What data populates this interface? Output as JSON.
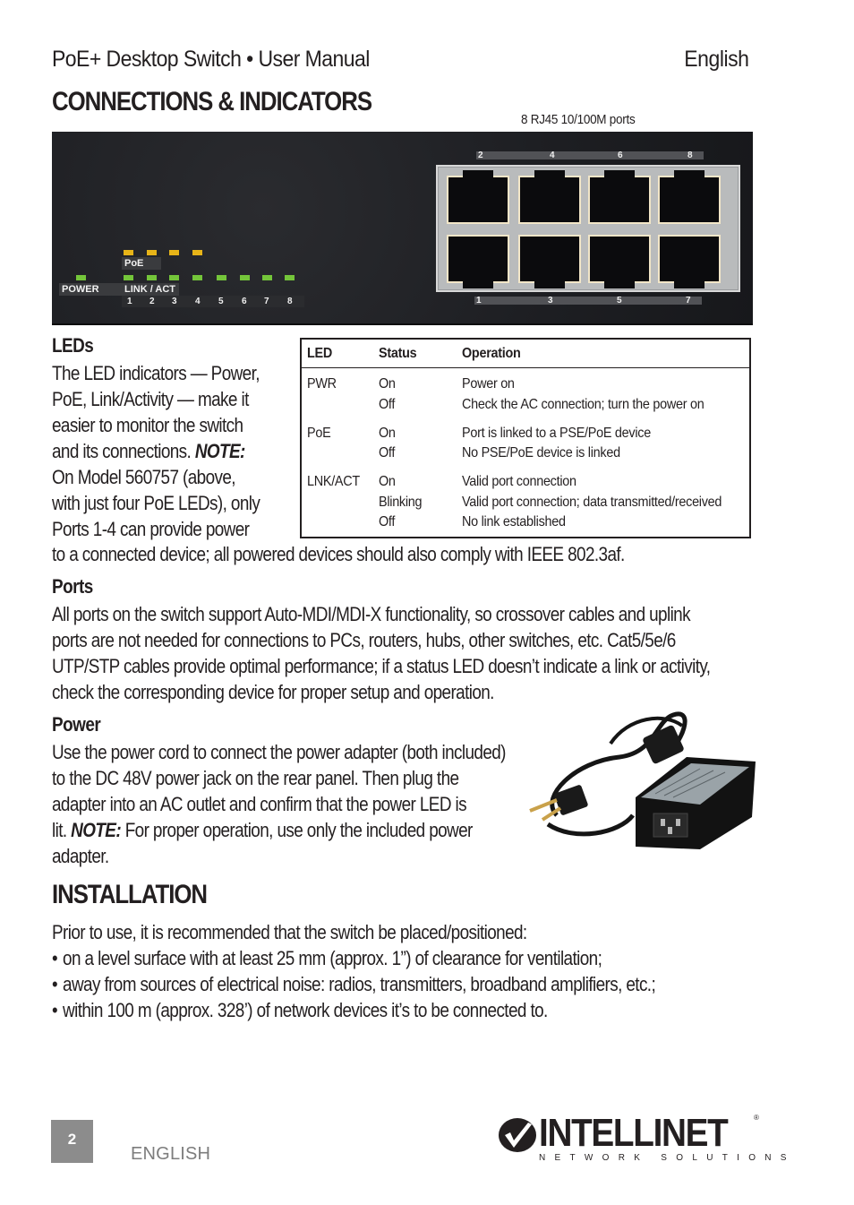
{
  "header": {
    "title": "PoE+ Desktop Switch • User Manual",
    "language": "English"
  },
  "connections": {
    "heading": "CONNECTIONS & INDICATORS",
    "ports_caption": "8 RJ45 10/100M ports",
    "front_panel": {
      "poe_label": "PoE",
      "power_label": "POWER",
      "link_label": "LINK / ACT",
      "led_numbers": [
        "1",
        "2",
        "3",
        "4",
        "5",
        "6",
        "7",
        "8"
      ],
      "poe_led_count": 4,
      "link_led_count": 8,
      "top_port_numbers": [
        "2",
        "4",
        "6",
        "8"
      ],
      "bottom_port_numbers": [
        "1",
        "3",
        "5",
        "7"
      ],
      "led_colors": {
        "link": "#74c53a",
        "poe": "#e7b418"
      }
    }
  },
  "leds": {
    "heading": "LEDs",
    "paragraph_lines": [
      "The LED indicators — Power,",
      "PoE, Link/Activity — make it",
      "easier to monitor the switch",
      "and its connections. ",
      "On Model 560757 (above,",
      "with just four PoE LEDs), only",
      "Ports 1-4 can provide power"
    ],
    "note_label": "NOTE:",
    "tail_line": "to a connected device; all powered devices should also comply with IEEE 802.3af."
  },
  "led_table": {
    "headers": [
      "LED",
      "Status",
      "Operation"
    ],
    "rows": [
      {
        "led": "PWR",
        "statuses": [
          "On",
          "Off"
        ],
        "operations": [
          "Power on",
          "Check the AC connection; turn the power on"
        ]
      },
      {
        "led": "PoE",
        "statuses": [
          "On",
          "Off"
        ],
        "operations": [
          "Port is linked to a PSE/PoE device",
          "No PSE/PoE device is linked"
        ]
      },
      {
        "led": "LNK/ACT",
        "statuses": [
          "On",
          "Blinking",
          "Off"
        ],
        "operations": [
          "Valid port connection",
          "Valid port connection; data transmitted/received",
          "No link established"
        ]
      }
    ]
  },
  "ports": {
    "heading": "Ports",
    "paragraph_lines": [
      "All ports on the switch support Auto-MDI/MDI-X functionality, so crossover cables and uplink",
      "ports are not needed for connections to PCs, routers, hubs, other switches, etc. Cat5/5e/6",
      "UTP/STP cables provide optimal performance; if a status LED doesn’t indicate a link or activity,",
      "check the corresponding device for proper setup and operation."
    ]
  },
  "power": {
    "heading": "Power",
    "paragraph_lines": [
      "Use the power cord to connect the power adapter (both included)",
      "to the DC 48V power jack on the rear panel. Then plug the",
      "adapter into an AC outlet and confirm that the power LED is"
    ],
    "line4_prefix": "lit. ",
    "note_label": "NOTE:",
    "line4_suffix": " For proper operation, use only the included power",
    "line5": "adapter."
  },
  "installation": {
    "heading": "INSTALLATION",
    "intro": "Prior to use, it is recommended that the switch be placed/positioned:",
    "bullets": [
      "on a level surface with at least 25 mm (approx. 1”) of clearance for ventilation;",
      "away from sources of electrical noise: radios, transmitters, broadband amplifiers, etc.;",
      "within 100 m (approx. 328’) of network devices it’s to be connected to."
    ],
    "bullet_char": "•"
  },
  "footer": {
    "page_number": "2",
    "language": "ENGLISH",
    "brand": "INTELLINET",
    "brand_tagline": "NETWORK SOLUTIONS",
    "registered": "®"
  }
}
